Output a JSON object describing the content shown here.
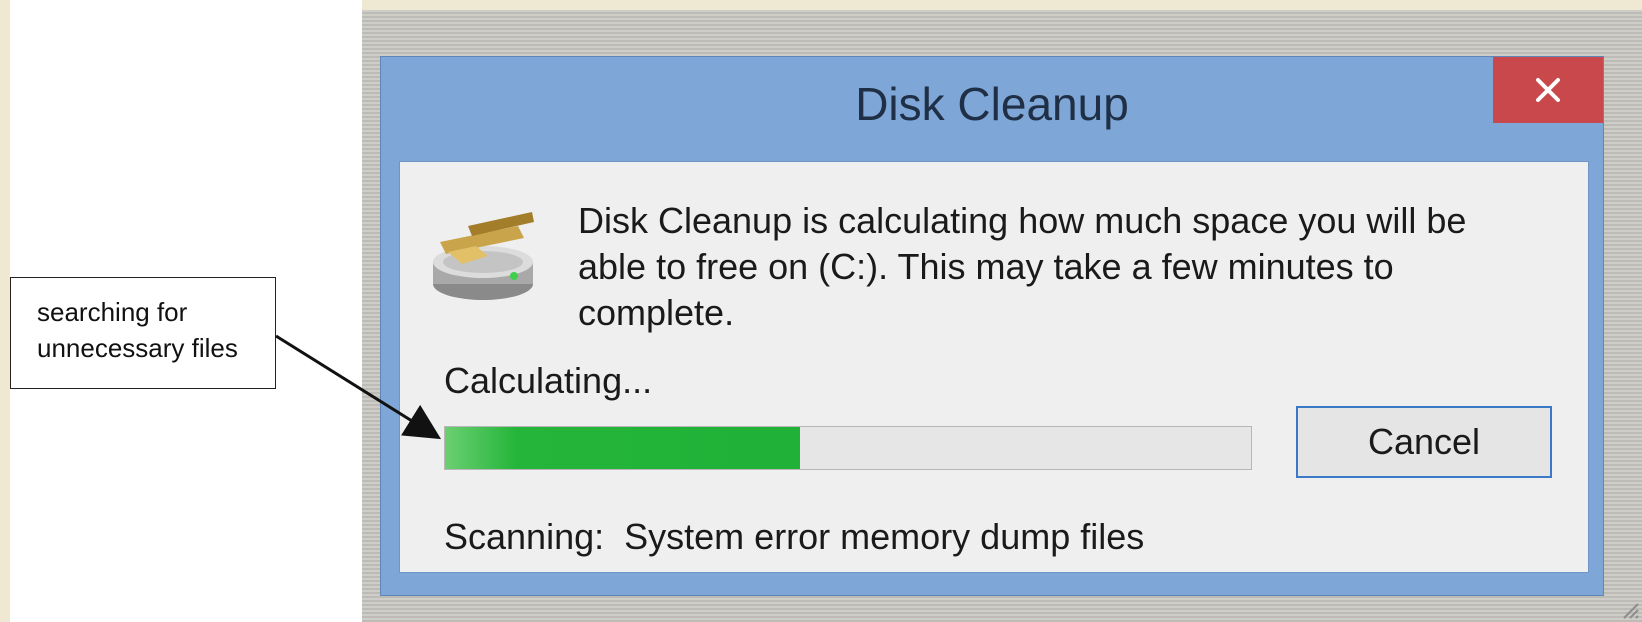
{
  "dialog": {
    "title": "Disk Cleanup",
    "close_icon": "close-icon",
    "disk_icon": "disk-cleanup-icon",
    "message": "Disk Cleanup is calculating how much space you will be able to free on  (C:). This may take a few minutes to complete.",
    "status_label": "Calculating...",
    "progress_fraction": 0.44,
    "cancel_label": "Cancel",
    "scan_prefix": "Scanning:",
    "scan_item": "System error memory dump files"
  },
  "callout": {
    "line1": "searching for",
    "line2": "unnecessary files"
  },
  "colors": {
    "title_bar": "#7ea6d6",
    "close_button": "#c9484c",
    "progress_green": "#1fb138",
    "button_border": "#3b78c8"
  }
}
